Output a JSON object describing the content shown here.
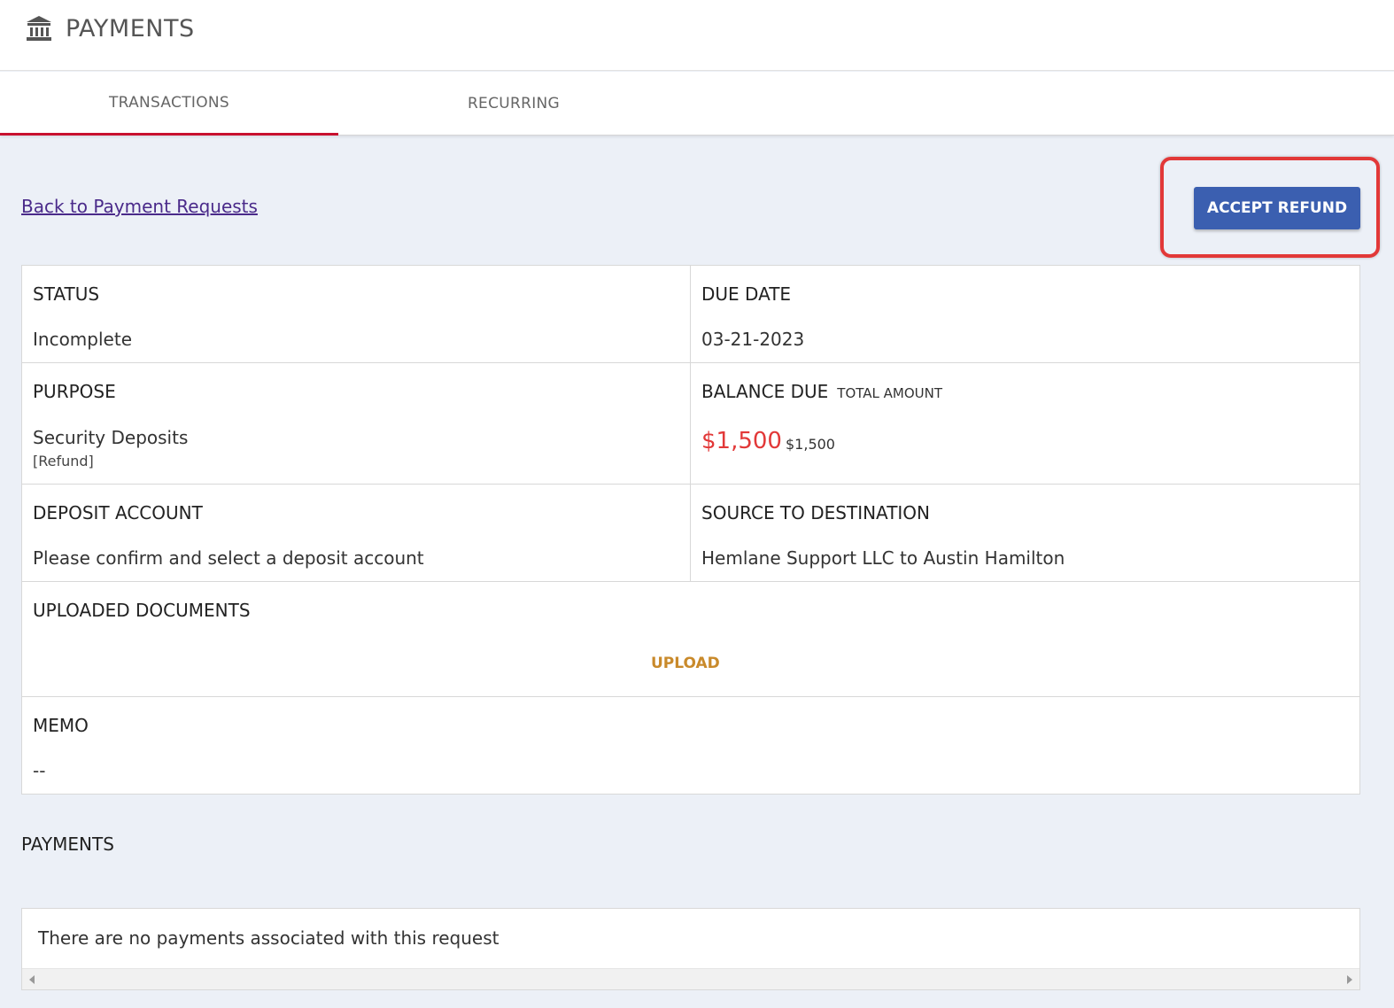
{
  "header": {
    "title": "PAYMENTS",
    "icon": "bank-icon"
  },
  "tabs": [
    {
      "label": "TRANSACTIONS",
      "active": true
    },
    {
      "label": "RECURRING",
      "active": false
    }
  ],
  "back_link": "Back to Payment Requests",
  "accept_button": "ACCEPT REFUND",
  "colors": {
    "accent": "#c8102e",
    "primary_button": "#3b5fb0",
    "amount_due": "#e23838",
    "upload": "#c98a2b"
  },
  "details": {
    "status": {
      "label": "STATUS",
      "value": "Incomplete"
    },
    "due_date": {
      "label": "DUE DATE",
      "value": "03-21-2023"
    },
    "purpose": {
      "label": "PURPOSE",
      "value": "Security Deposits",
      "sub": "[Refund]"
    },
    "balance": {
      "label": "BALANCE DUE",
      "total_label": "TOTAL AMOUNT",
      "due": "$1,500",
      "total": "$1,500"
    },
    "deposit_account": {
      "label": "DEPOSIT ACCOUNT",
      "value": "Please confirm and select a deposit account"
    },
    "source_destination": {
      "label": "SOURCE TO DESTINATION",
      "value": "Hemlane Support LLC to Austin Hamilton"
    },
    "documents": {
      "label": "UPLOADED DOCUMENTS",
      "upload_label": "UPLOAD"
    },
    "memo": {
      "label": "MEMO",
      "value": "--"
    }
  },
  "payments": {
    "heading": "PAYMENTS",
    "empty_message": "There are no payments associated with this request"
  }
}
